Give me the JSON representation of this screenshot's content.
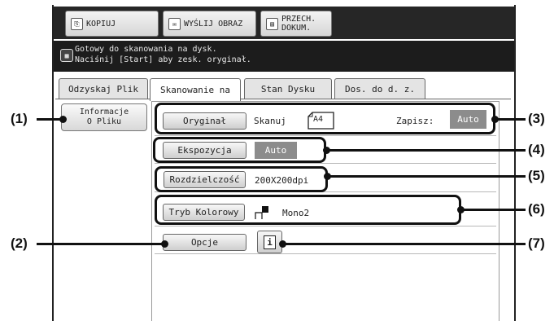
{
  "modes": [
    {
      "label": "KOPIUJ",
      "icon": "copier-icon"
    },
    {
      "label": "WYŚLIJ OBRAZ",
      "icon": "send-image-icon"
    },
    {
      "label": "PRZECH.\nDOKUM.",
      "icon": "document-filing-icon"
    }
  ],
  "message": {
    "line1": "Gotowy do skanowania na dysk.",
    "line2": "Naciśnij [Start] aby zesk. oryginał."
  },
  "tabs": [
    {
      "label": "Odzyskaj Plik",
      "active": false
    },
    {
      "label": "Skanowanie na",
      "active": true
    },
    {
      "label": "Stan Dysku",
      "active": false
    },
    {
      "label": "Dos. do d. z.",
      "active": false
    }
  ],
  "side": {
    "file_info": "Informacje\nO Pliku"
  },
  "settings": {
    "original": {
      "button": "Oryginał",
      "scan_label": "Skanuj",
      "scan_size": "A4",
      "save_label": "Zapisz:",
      "save_value": "Auto"
    },
    "exposure": {
      "button": "Ekspozycja",
      "value": "Auto"
    },
    "resolution": {
      "button": "Rozdzielczość",
      "value": "200X200dpi"
    },
    "color_mode": {
      "button": "Tryb Kolorowy",
      "value": "Mono2"
    },
    "options": {
      "button": "Opcje",
      "info_glyph": "i"
    }
  },
  "callouts": [
    "(1)",
    "(2)",
    "(3)",
    "(4)",
    "(5)",
    "(6)",
    "(7)"
  ]
}
